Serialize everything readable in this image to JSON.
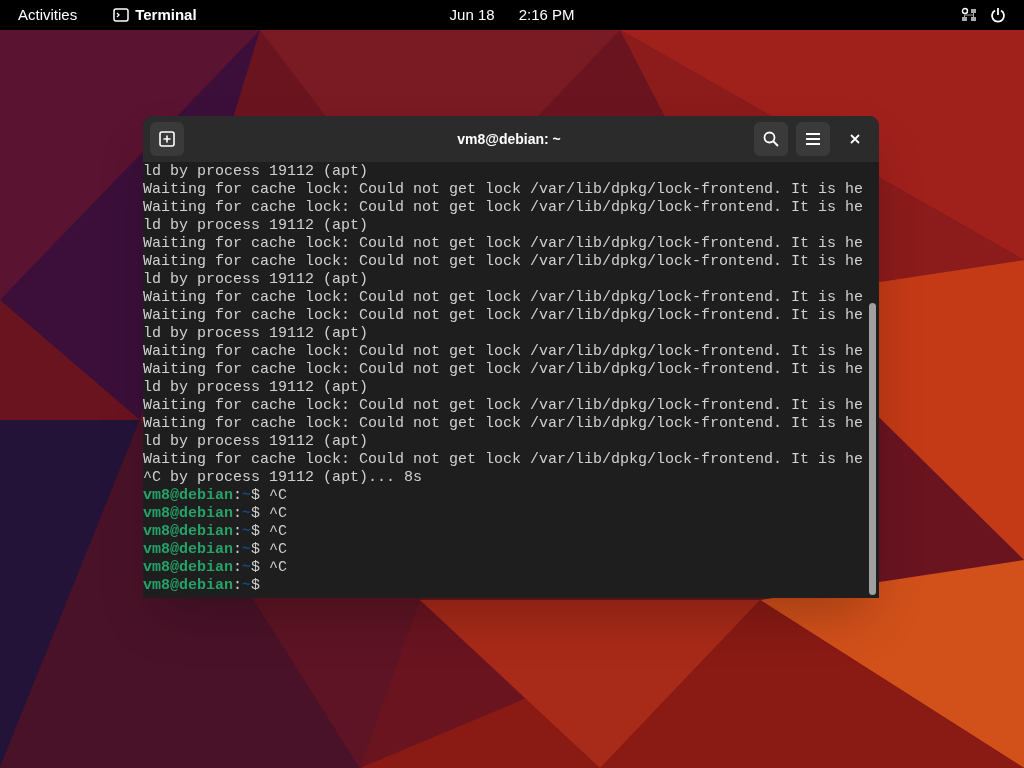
{
  "top_bar": {
    "activities": "Activities",
    "app": "Terminal",
    "date": "Jun 18",
    "time": "2:16 PM"
  },
  "window": {
    "title": "vm8@debian: ~"
  },
  "terminal": {
    "lines": [
      {
        "kind": "output",
        "text": "ld by process 19112 (apt)"
      },
      {
        "kind": "output",
        "text": "Waiting for cache lock: Could not get lock /var/lib/dpkg/lock-frontend. It is he"
      },
      {
        "kind": "output",
        "text": "Waiting for cache lock: Could not get lock /var/lib/dpkg/lock-frontend. It is he"
      },
      {
        "kind": "output",
        "text": "ld by process 19112 (apt)"
      },
      {
        "kind": "output",
        "text": "Waiting for cache lock: Could not get lock /var/lib/dpkg/lock-frontend. It is he"
      },
      {
        "kind": "output",
        "text": "Waiting for cache lock: Could not get lock /var/lib/dpkg/lock-frontend. It is he"
      },
      {
        "kind": "output",
        "text": "ld by process 19112 (apt)"
      },
      {
        "kind": "output",
        "text": "Waiting for cache lock: Could not get lock /var/lib/dpkg/lock-frontend. It is he"
      },
      {
        "kind": "output",
        "text": "Waiting for cache lock: Could not get lock /var/lib/dpkg/lock-frontend. It is he"
      },
      {
        "kind": "output",
        "text": "ld by process 19112 (apt)"
      },
      {
        "kind": "output",
        "text": "Waiting for cache lock: Could not get lock /var/lib/dpkg/lock-frontend. It is he"
      },
      {
        "kind": "output",
        "text": "Waiting for cache lock: Could not get lock /var/lib/dpkg/lock-frontend. It is he"
      },
      {
        "kind": "output",
        "text": "ld by process 19112 (apt)"
      },
      {
        "kind": "output",
        "text": "Waiting for cache lock: Could not get lock /var/lib/dpkg/lock-frontend. It is he"
      },
      {
        "kind": "output",
        "text": "Waiting for cache lock: Could not get lock /var/lib/dpkg/lock-frontend. It is he"
      },
      {
        "kind": "output",
        "text": "ld by process 19112 (apt)"
      },
      {
        "kind": "output",
        "text": "Waiting for cache lock: Could not get lock /var/lib/dpkg/lock-frontend. It is he"
      },
      {
        "kind": "output",
        "text": "^C by process 19112 (apt)... 8s"
      },
      {
        "kind": "prompt",
        "user": "vm8@debian",
        "separator": ":",
        "path": "~",
        "symbol": "$",
        "command": "^C"
      },
      {
        "kind": "prompt",
        "user": "vm8@debian",
        "separator": ":",
        "path": "~",
        "symbol": "$",
        "command": "^C"
      },
      {
        "kind": "prompt",
        "user": "vm8@debian",
        "separator": ":",
        "path": "~",
        "symbol": "$",
        "command": "^C"
      },
      {
        "kind": "prompt",
        "user": "vm8@debian",
        "separator": ":",
        "path": "~",
        "symbol": "$",
        "command": "^C"
      },
      {
        "kind": "prompt",
        "user": "vm8@debian",
        "separator": ":",
        "path": "~",
        "symbol": "$",
        "command": "^C"
      },
      {
        "kind": "prompt",
        "user": "vm8@debian",
        "separator": ":",
        "path": "~",
        "symbol": "$"
      }
    ]
  }
}
